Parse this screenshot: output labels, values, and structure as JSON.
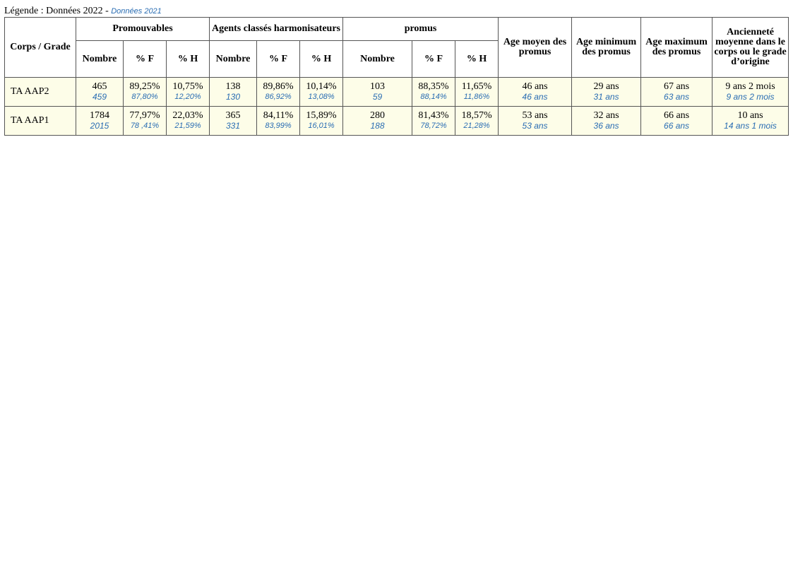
{
  "legend": {
    "prefix": "Légende : Données 2022 - ",
    "secondary": "Données 2021"
  },
  "headers": {
    "corps_grade": "Corps / Grade",
    "promouvables": "Promouvables",
    "agents": "Agents classés harmonisateurs",
    "promus": "promus",
    "age_moyen": "Age moyen des promus",
    "age_min": "Age minimum des promus",
    "age_max": "Age maximum des promus",
    "anciennete": "Ancienneté moyenne dans le corps ou le grade d’origine",
    "nombre": "Nombre",
    "pct_f": "% F",
    "pct_h": "% H"
  },
  "rows": [
    {
      "label": "TA AAP2",
      "prom_nombre": {
        "y2022": "465",
        "y2021": "459"
      },
      "prom_f": {
        "y2022": "89,25%",
        "y2021": "87,80%"
      },
      "prom_h": {
        "y2022": "10,75%",
        "y2021": "12,20%"
      },
      "ag_nombre": {
        "y2022": "138",
        "y2021": "130"
      },
      "ag_f": {
        "y2022": "89,86%",
        "y2021": "86,92%"
      },
      "ag_h": {
        "y2022": "10,14%",
        "y2021": "13,08%"
      },
      "pr_nombre": {
        "y2022": "103",
        "y2021": "59"
      },
      "pr_f": {
        "y2022": "88,35%",
        "y2021": "88,14%"
      },
      "pr_h": {
        "y2022": "11,65%",
        "y2021": "11,86%"
      },
      "age_moyen": {
        "y2022": "46 ans",
        "y2021": "46 ans"
      },
      "age_min": {
        "y2022": "29 ans",
        "y2021": "31 ans"
      },
      "age_max": {
        "y2022": "67 ans",
        "y2021": "63 ans"
      },
      "anciennete": {
        "y2022": "9 ans 2 mois",
        "y2021": "9 ans 2 mois"
      }
    },
    {
      "label": "TA AAP1",
      "prom_nombre": {
        "y2022": "1784",
        "y2021": "2015"
      },
      "prom_f": {
        "y2022": "77,97%",
        "y2021": "78 ,41%"
      },
      "prom_h": {
        "y2022": "22,03%",
        "y2021": "21,59%"
      },
      "ag_nombre": {
        "y2022": "365",
        "y2021": "331"
      },
      "ag_f": {
        "y2022": "84,11%",
        "y2021": "83,99%"
      },
      "ag_h": {
        "y2022": "15,89%",
        "y2021": "16,01%"
      },
      "pr_nombre": {
        "y2022": "280",
        "y2021": "188"
      },
      "pr_f": {
        "y2022": "81,43%",
        "y2021": "78,72%"
      },
      "pr_h": {
        "y2022": "18,57%",
        "y2021": "21,28%"
      },
      "age_moyen": {
        "y2022": "53 ans",
        "y2021": "53 ans"
      },
      "age_min": {
        "y2022": "32 ans",
        "y2021": "36 ans"
      },
      "age_max": {
        "y2022": "66 ans",
        "y2021": "66 ans"
      },
      "anciennete": {
        "y2022": "10 ans",
        "y2021": "14 ans 1 mois"
      }
    }
  ]
}
